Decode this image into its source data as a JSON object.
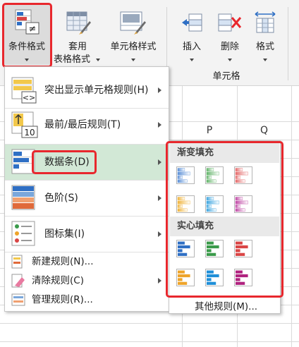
{
  "ribbon": {
    "conditional_formatting": "条件格式",
    "format_as_table_line1": "套用",
    "format_as_table_line2": "表格格式",
    "cell_styles": "单元格样式",
    "insert": "插入",
    "delete": "删除",
    "format": "格式",
    "cells_group": "单元格"
  },
  "columns": [
    "P",
    "Q"
  ],
  "menu": {
    "items": [
      {
        "label": "突出显示单元格规则(H)",
        "icon": "highlight-cells-icon"
      },
      {
        "label": "最前/最后规则(T)",
        "icon": "top-bottom-icon"
      },
      {
        "label": "数据条(D)",
        "icon": "data-bars-icon"
      },
      {
        "label": "色阶(S)",
        "icon": "color-scales-icon"
      },
      {
        "label": "图标集(I)",
        "icon": "icon-sets-icon"
      }
    ],
    "small_items": [
      {
        "label": "新建规则(N)...",
        "icon": "new-rule-icon"
      },
      {
        "label": "清除规则(C)",
        "icon": "clear-rules-icon"
      },
      {
        "label": "管理规则(R)...",
        "icon": "manage-rules-icon"
      }
    ]
  },
  "submenu": {
    "gradient_header": "渐变填充",
    "solid_header": "实心填充",
    "more_rules": "其他规则(M)...",
    "gradient_colors": [
      "#5b8fd6",
      "#63b46a",
      "#e46a6a",
      "#f0b43c",
      "#3ea6e0",
      "#c04aa6"
    ],
    "solid_colors": [
      "#2f6fc4",
      "#3a9a4a",
      "#d94545",
      "#eea42a",
      "#1f8fd8",
      "#b0237f"
    ]
  },
  "colors": {
    "highlight_red": "#e8272d",
    "selected_item_bg": "#d2e8d6"
  }
}
